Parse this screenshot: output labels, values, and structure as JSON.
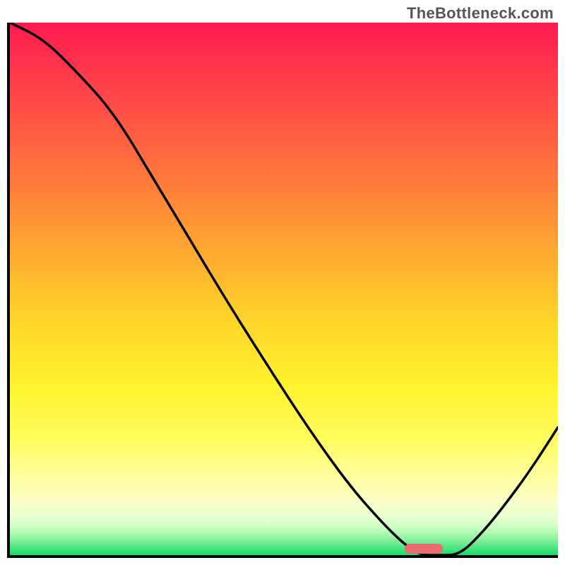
{
  "watermark": "TheBottleneck.com",
  "colors": {
    "axis": "#000000",
    "curve": "#000000",
    "marker": "#e96a72",
    "gradient_top": "#ff1a50",
    "gradient_bottom": "#14db6c"
  },
  "chart_data": {
    "type": "line",
    "title": "",
    "xlabel": "",
    "ylabel": "",
    "xlim": [
      0,
      100
    ],
    "ylim": [
      0,
      100
    ],
    "x": [
      0,
      6,
      12,
      19,
      26,
      33,
      40,
      48,
      55,
      62,
      68,
      72,
      75,
      78,
      82,
      86,
      90,
      95,
      100
    ],
    "values": [
      100,
      97,
      91,
      83,
      71,
      59,
      47,
      34,
      23,
      13,
      6,
      2,
      0,
      0,
      0,
      4,
      9,
      16,
      24
    ],
    "marker": {
      "x_start": 72,
      "x_end": 79,
      "y": 0
    }
  }
}
